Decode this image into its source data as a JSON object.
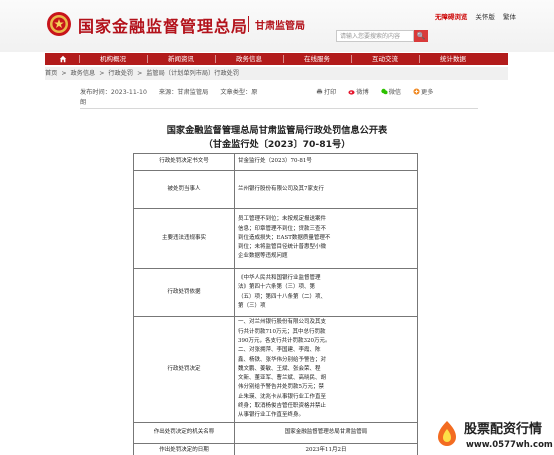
{
  "header": {
    "site_title": "国家金融监督管理总局",
    "site_sub": "甘肃监管局",
    "links": [
      "无障碍浏览",
      "关怀版",
      "繁体"
    ],
    "search_placeholder": "请输入您要搜索的内容",
    "search_button": "🔍"
  },
  "nav": {
    "items": [
      "首页",
      "机构概况",
      "新闻资讯",
      "政务信息",
      "在线服务",
      "互动交流",
      "统计数据"
    ]
  },
  "breadcrumb": {
    "items": [
      "首页",
      ">",
      "政务信息",
      ">",
      "行政处罚",
      ">",
      "监管局（计划单列市局）行政处罚"
    ]
  },
  "meta": {
    "date": "发布时间：2023-11-10",
    "date_tail": "朗",
    "source": "来源：甘肃监管局",
    "type": "文章类型：原",
    "print": "打印",
    "weibo": "微博",
    "wechat": "微信",
    "more": "更多"
  },
  "article": {
    "title_line1": "国家金融监督管理总局甘肃监管局行政处罚信息公开表",
    "title_line2": "（甘金监行处〔2023〕70-81号）"
  },
  "table": {
    "rows": [
      {
        "label": "行政处罚决定书文号",
        "value": [
          "甘金监行处（2023）70-81号"
        ]
      },
      {
        "label": "被处罚当事人",
        "value": [
          "兰州银行股份有限公司及其7家支行"
        ]
      },
      {
        "label": "主要违法违规事实",
        "value": [
          "员工管理不到位；未按规定报送案件",
          "信息；印章管理不到位；贷款三查不",
          "到位造成损失；EAST数据质量管理不",
          "到位；未将监管目径统计普惠型小微",
          "企业数据等违规问题"
        ]
      },
      {
        "label": "行政处罚依据",
        "value": [
          "《中华人民共和国银行业监督管理",
          "法》第四十六条第（三）项、第",
          "（五）项；第四十八条第（二）项、",
          "第（三）项"
        ]
      },
      {
        "label": "行政处罚决定",
        "value": [
          "一、对兰州银行股份有限公司及其支",
          "行共计罚款710万元；其中总行罚款",
          "390万元，各支行共计罚款320万元。",
          "二、对张拥萍、李国建、李霞、陈",
          "鑫、杨铁、张华伟分别给予警告；对",
          "魏文鹏、姜敏、王斌、张会荣、程",
          "文新、董亚军、曹兰斌、高晓民、胡",
          "伟分别给予警告并处罚款5万元；禁",
          "止朱瑛、沈兆卡从事银行业工作直至",
          "终身；取消杨俊吉管任职资格并禁止",
          "从事银行业工作直至终身。"
        ]
      },
      {
        "label": "作出处罚决定的机关名称",
        "value": [
          "国家金融监督管理总局甘肃监管局"
        ]
      },
      {
        "label": "作出处罚决定的日期",
        "value": [
          "2023年11月2日"
        ]
      }
    ]
  },
  "watermark": {
    "line1": "股票配资行情",
    "line2": "www.0577wh.com"
  }
}
